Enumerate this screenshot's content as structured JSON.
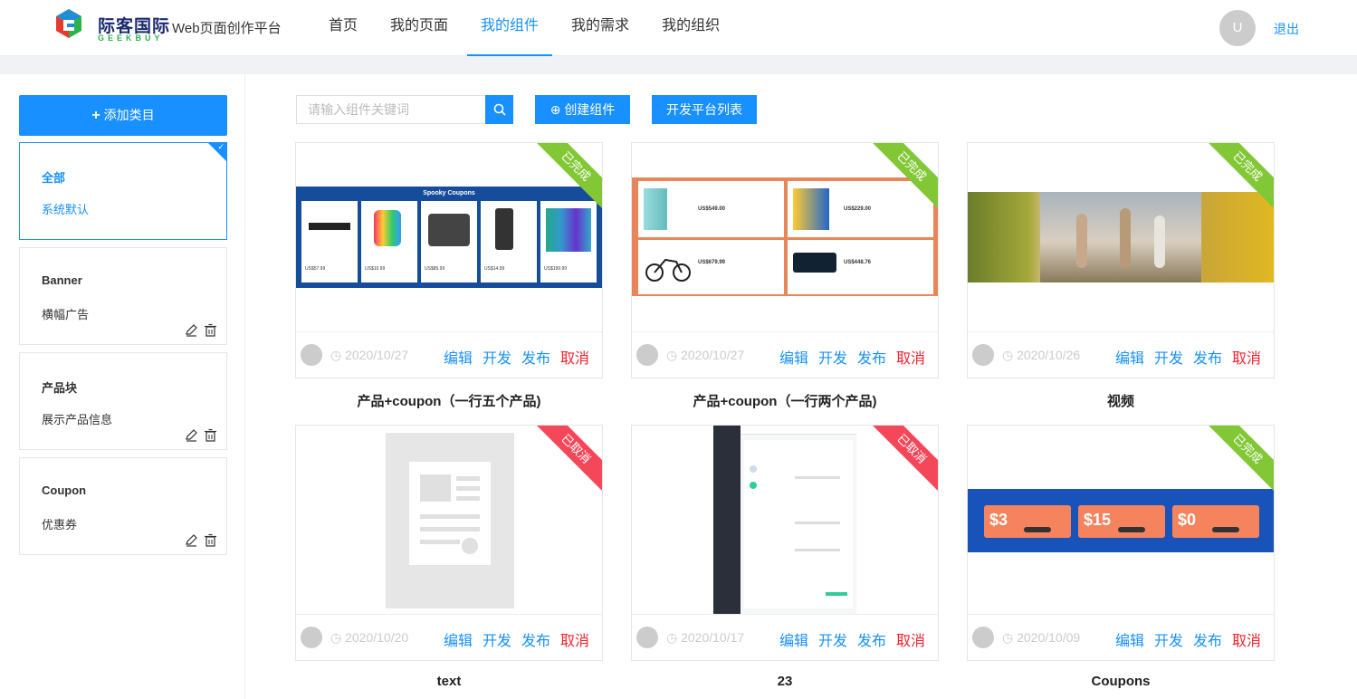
{
  "header": {
    "logo_text": "际客国际",
    "logo_sub": "GEEKBUY",
    "platform_title": "Web页面创作平台",
    "nav": [
      "首页",
      "我的页面",
      "我的组件",
      "我的需求",
      "我的组织"
    ],
    "active_nav": "我的组件",
    "avatar_letter": "U",
    "logout": "退出"
  },
  "sidebar": {
    "add_label": "添加类目",
    "categories": [
      {
        "name": "全部",
        "desc": "系统默认",
        "active": true
      },
      {
        "name": "Banner",
        "desc": "横幅广告",
        "active": false
      },
      {
        "name": "产品块",
        "desc": "展示产品信息",
        "active": false
      },
      {
        "name": "Coupon",
        "desc": "优惠券",
        "active": false
      }
    ]
  },
  "toolbar": {
    "search_placeholder": "请输入组件关键词",
    "create_label": "创建组件",
    "dev_platform_label": "开发平台列表"
  },
  "actions": {
    "edit": "编辑",
    "develop": "开发",
    "publish": "发布",
    "cancel": "取消"
  },
  "status": {
    "done": "已完成",
    "cancelled": "已取消"
  },
  "cards": [
    {
      "title": "产品+coupon（一行五个产品)",
      "date": "2020/10/27",
      "status": "已完成"
    },
    {
      "title": "产品+coupon（一行两个产品)",
      "date": "2020/10/27",
      "status": "已完成"
    },
    {
      "title": "视频",
      "date": "2020/10/26",
      "status": "已完成"
    },
    {
      "title": "text",
      "date": "2020/10/20",
      "status": "已取消"
    },
    {
      "title": "23",
      "date": "2020/10/17",
      "status": "已取消"
    },
    {
      "title": "Coupons",
      "date": "2020/10/09",
      "status": "已完成"
    }
  ],
  "thumb_text": {
    "spooky": "Spooky Coupons",
    "p1": "US$57.99",
    "p2": "US$10.99",
    "p3": "US$85.99",
    "p4": "US$14.99",
    "p5": "US$199.99",
    "q1": "US$549.00",
    "q2": "US$229.00",
    "q3": "US$679.99",
    "q4": "US$448.76",
    "c1": "$3",
    "c2": "$15",
    "c3": "$0"
  },
  "colors": {
    "primary": "#1890ff",
    "done": "#82c836",
    "cancelled": "#f5475a"
  }
}
